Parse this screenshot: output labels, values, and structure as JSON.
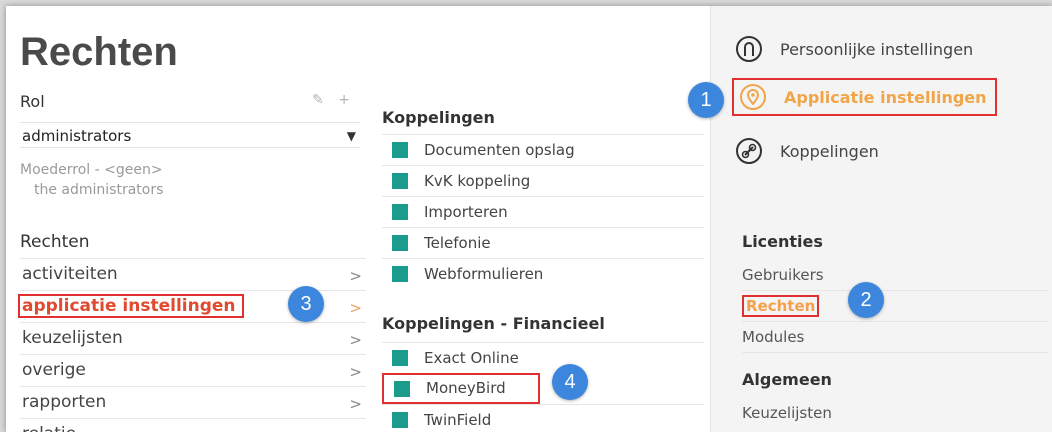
{
  "page": {
    "title": "Rechten"
  },
  "rol": {
    "label": "Rol",
    "edit_icon": "pencil-icon",
    "add_icon": "plus-icon",
    "selected": "administrators",
    "moederrol": "Moederrol - <geen>",
    "description": "the administrators"
  },
  "rechten": {
    "heading": "Rechten",
    "items": [
      {
        "label": "activiteiten"
      },
      {
        "label": "applicatie instellingen"
      },
      {
        "label": "keuzelijsten"
      },
      {
        "label": "overige"
      },
      {
        "label": "rapporten"
      },
      {
        "label": "relatie"
      }
    ]
  },
  "koppelingen": {
    "heading": "Koppelingen",
    "items": [
      {
        "label": "Documenten opslag"
      },
      {
        "label": "KvK koppeling"
      },
      {
        "label": "Importeren"
      },
      {
        "label": "Telefonie"
      },
      {
        "label": "Webformulieren"
      }
    ]
  },
  "koppelingen_financieel": {
    "heading": "Koppelingen - Financieel",
    "items": [
      {
        "label": "Exact Online"
      },
      {
        "label": "MoneyBird"
      },
      {
        "label": "TwinField"
      }
    ]
  },
  "right_panel": {
    "nav": [
      {
        "label": "Persoonlijke instellingen",
        "icon": "user-icon"
      },
      {
        "label": "Applicatie instellingen",
        "icon": "location-pin-icon"
      },
      {
        "label": "Koppelingen",
        "icon": "link-icon"
      }
    ],
    "licenties_heading": "Licenties",
    "licenties": [
      {
        "label": "Gebruikers"
      },
      {
        "label": "Rechten"
      },
      {
        "label": "Modules"
      }
    ],
    "algemeen_heading": "Algemeen",
    "algemeen": [
      {
        "label": "Keuzelijsten"
      }
    ]
  },
  "badges": [
    "1",
    "2",
    "3",
    "4"
  ],
  "colors": {
    "teal": "#1b9b8c",
    "highlight_red": "#e03030",
    "active_orange": "#f0a548",
    "badge_blue": "#3d86dd"
  }
}
